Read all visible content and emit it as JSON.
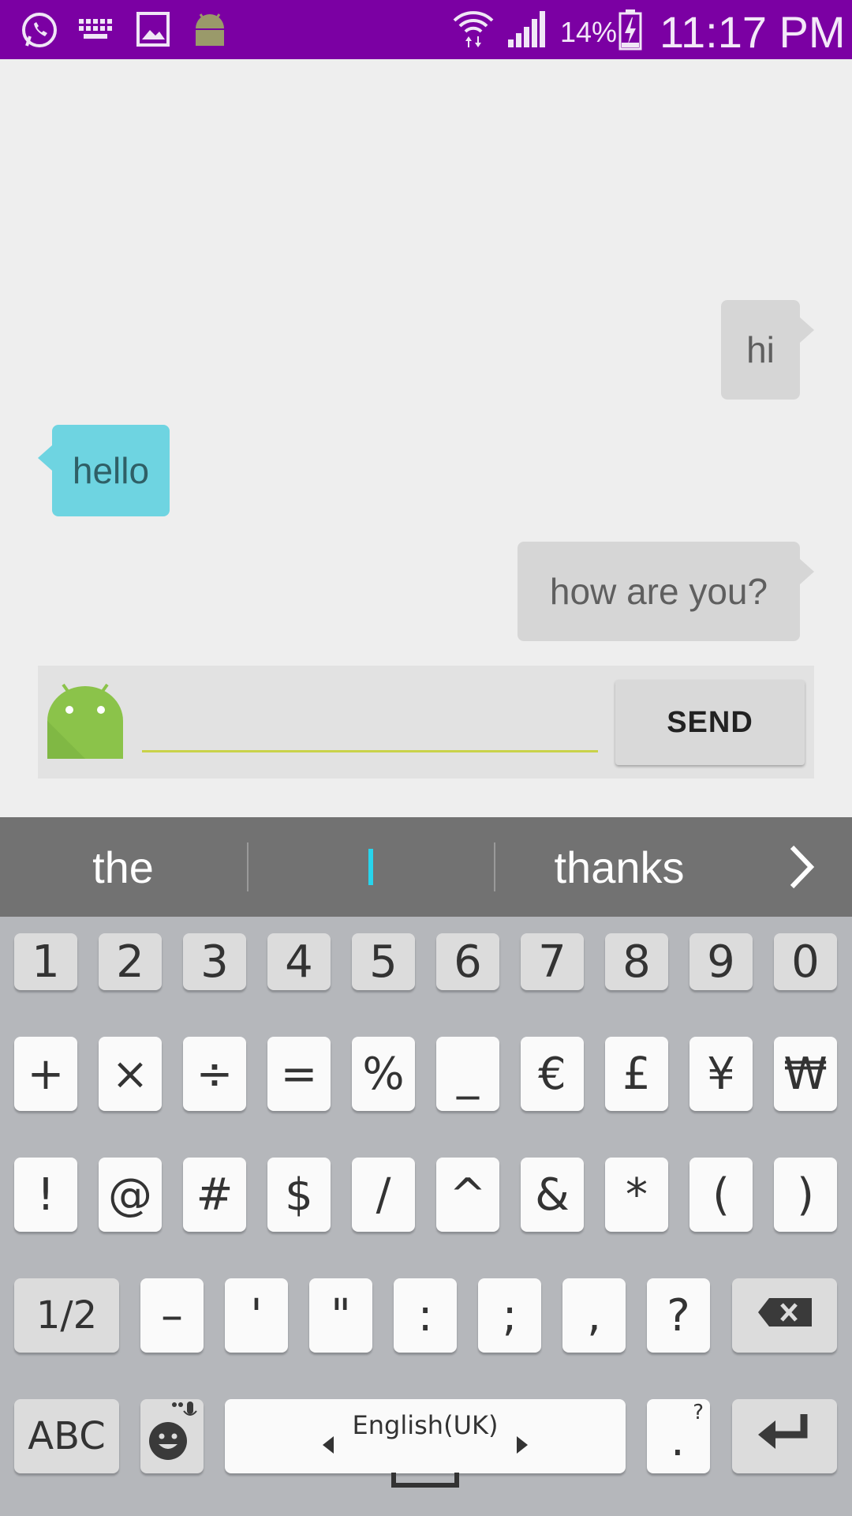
{
  "status_bar": {
    "battery_percent": "14%",
    "time": "11:17 PM",
    "background": "#7b00a3",
    "icons": [
      "whatsapp-icon",
      "keyboard-icon",
      "gallery-icon",
      "android-icon",
      "wifi-icon",
      "signal-icon",
      "battery-charging-icon"
    ]
  },
  "chat": {
    "messages": [
      {
        "from": "self",
        "text": "hi"
      },
      {
        "from": "other",
        "text": "hello"
      },
      {
        "from": "self",
        "text": "how are you?"
      }
    ],
    "composer": {
      "input_value": "",
      "send_label": "SEND"
    }
  },
  "suggestions": {
    "left": "the",
    "right": "thanks"
  },
  "keyboard": {
    "row1": [
      "1",
      "2",
      "3",
      "4",
      "5",
      "6",
      "7",
      "8",
      "9",
      "0"
    ],
    "row2": [
      "+",
      "×",
      "÷",
      "=",
      "%",
      "_",
      "€",
      "£",
      "¥",
      "₩"
    ],
    "row3": [
      "!",
      "@",
      "#",
      "$",
      "/",
      "^",
      "&",
      "*",
      "(",
      ")"
    ],
    "row4": [
      "1/2",
      "–",
      "'",
      "\"",
      ":",
      ";",
      ",",
      "?"
    ],
    "row5": {
      "abc": "ABC",
      "language": "English(UK)",
      "period": ".",
      "period_hint": "?"
    }
  }
}
